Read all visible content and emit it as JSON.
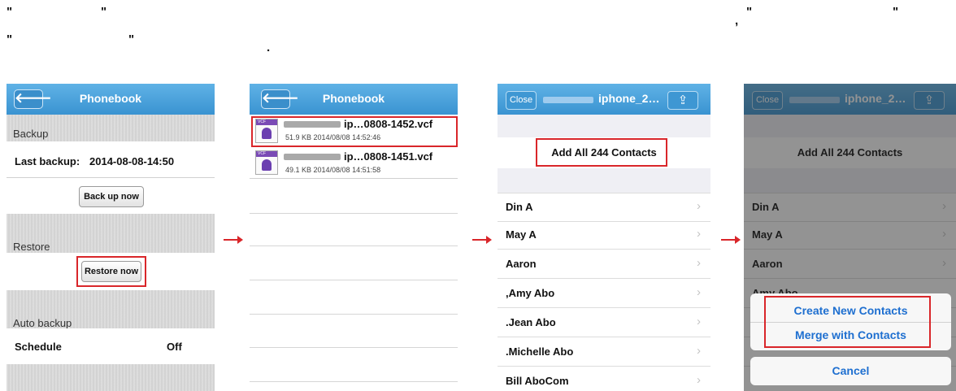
{
  "top_quotes": [
    "\"",
    "\"",
    "\"",
    "\"",
    "\"",
    "\"",
    ",",
    "."
  ],
  "panel1": {
    "title": "Phonebook",
    "back_glyph": "🡐",
    "backup_label": "Backup",
    "last_backup_label": "Last backup:",
    "last_backup_value": "2014-08-08-14:50",
    "backup_button": "Back up now",
    "restore_label": "Restore",
    "restore_button": "Restore now",
    "auto_backup_label": "Auto backup",
    "schedule_label": "Schedule",
    "schedule_value": "Off"
  },
  "panel2": {
    "title": "Phonebook",
    "back_glyph": "🡐",
    "files": [
      {
        "name": "ip…0808-1452.vcf",
        "meta": "51.9 KB 2014/08/08 14:52:46",
        "icon_tag": "VCF"
      },
      {
        "name": "ip…0808-1451.vcf",
        "meta": "49.1 KB 2014/08/08 14:51:58",
        "icon_tag": "VCF"
      }
    ]
  },
  "panel3": {
    "close_button": "Close",
    "title": "iphone_2…",
    "share_glyph": "⇪",
    "add_all": "Add All 244 Contacts",
    "contacts": [
      "Din A",
      "May A",
      "Aaron",
      ",Amy Abo",
      ".Jean Abo",
      ".Michelle Abo",
      "Bill AboCom"
    ],
    "chevron": "›"
  },
  "panel4": {
    "close_button": "Close",
    "title": "iphone_2…",
    "share_glyph": "⇪",
    "add_all": "Add All 244 Contacts",
    "contacts": [
      "Din A",
      "May A",
      "Aaron",
      "Amy Abo"
    ],
    "chevron": "›",
    "create_new": "Create New Contacts",
    "merge": "Merge with Contacts",
    "cancel": "Cancel"
  },
  "colors": {
    "highlight": "#d9262a",
    "navbar": "#3a93d1",
    "sheet_text": "#1e6fd0"
  }
}
